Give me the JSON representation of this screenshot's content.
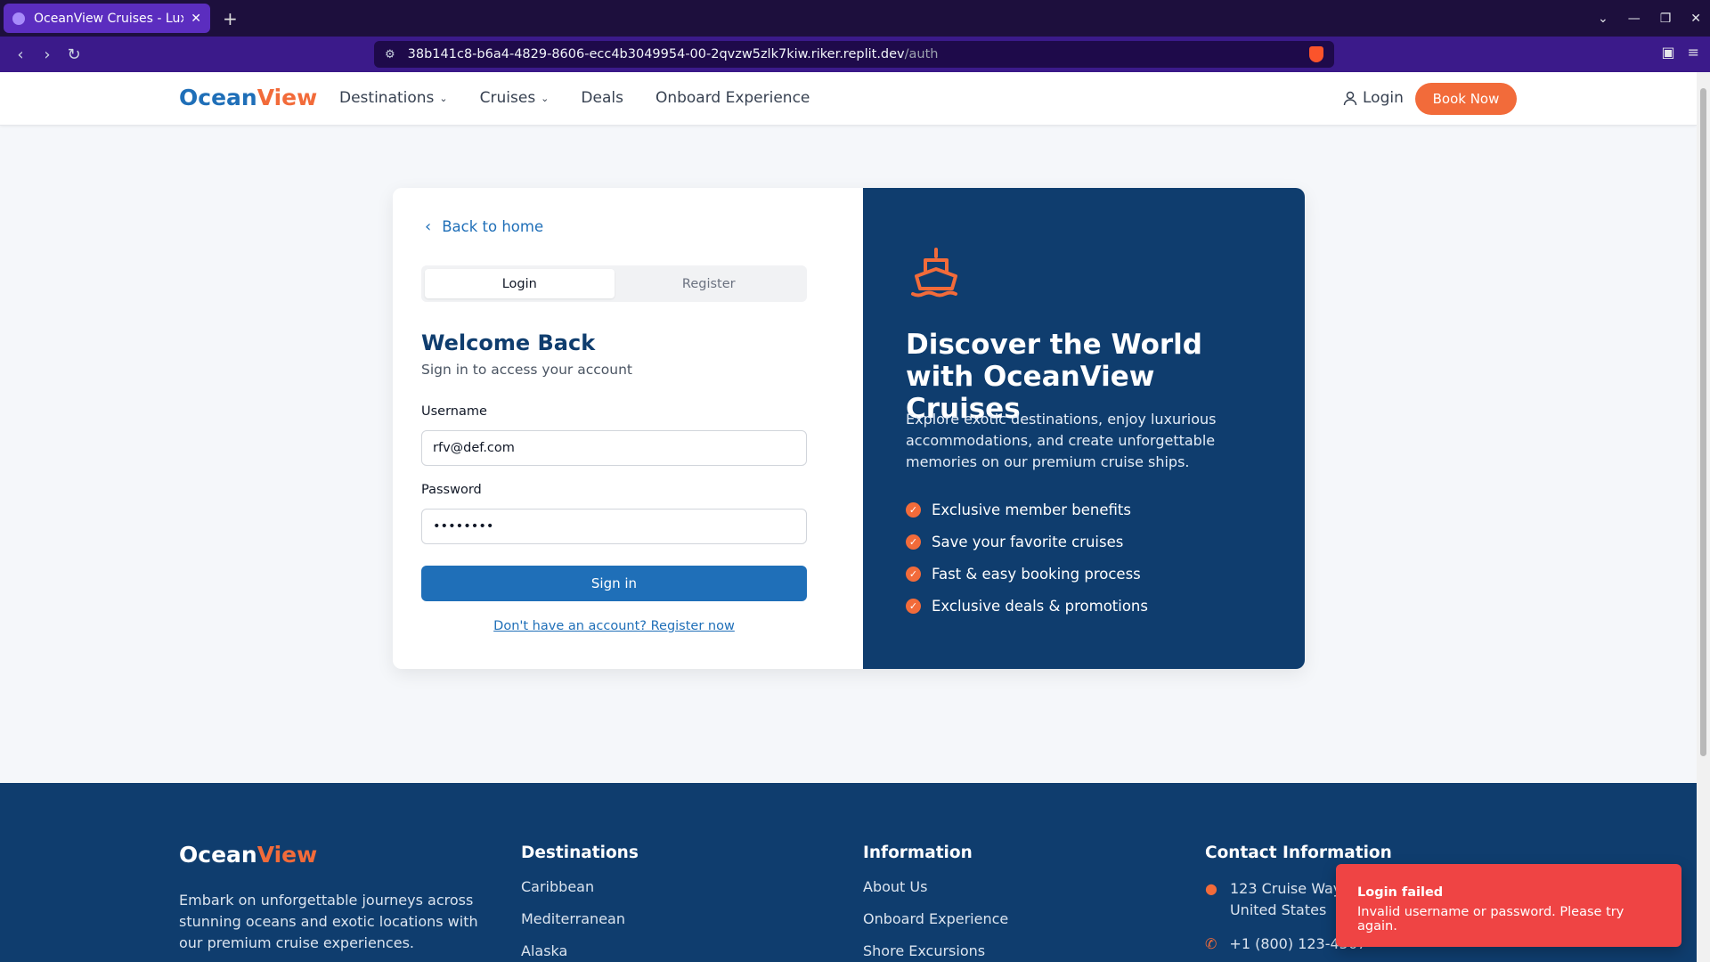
{
  "browser": {
    "tab_title": "OceanView Cruises - Luxury",
    "url_host": "38b141c8-b6a4-4829-8606-ecc4b3049954-00-2qvzw5zlk7kiw.riker.replit.dev",
    "url_path": "/auth"
  },
  "header": {
    "logo_part1": "Ocean",
    "logo_part2": "View",
    "nav": [
      "Destinations",
      "Cruises",
      "Deals",
      "Onboard Experience"
    ],
    "login": "Login",
    "book_now": "Book Now"
  },
  "auth": {
    "back": "Back to home",
    "tabs": [
      "Login",
      "Register"
    ],
    "active_tab": "Login",
    "title": "Welcome Back",
    "subtitle": "Sign in to access your account",
    "username_label": "Username",
    "username_value": "rfv@def.com",
    "password_label": "Password",
    "password_value": "••••••••",
    "signin": "Sign in",
    "register_link": "Don't have an account? Register now"
  },
  "promo": {
    "title": "Discover the World with OceanView Cruises",
    "description": "Explore exotic destinations, enjoy luxurious accommodations, and create unforgettable memories on our premium cruise ships.",
    "benefits": [
      "Exclusive member benefits",
      "Save your favorite cruises",
      "Fast & easy booking process",
      "Exclusive deals & promotions"
    ]
  },
  "footer": {
    "logo_part1": "Ocean",
    "logo_part2": "View",
    "description": "Embark on unforgettable journeys across stunning oceans and exotic locations with our premium cruise experiences.",
    "destinations_title": "Destinations",
    "destinations": [
      "Caribbean",
      "Mediterranean",
      "Alaska"
    ],
    "information_title": "Information",
    "information": [
      "About Us",
      "Onboard Experience",
      "Shore Excursions"
    ],
    "contact_title": "Contact Information",
    "address": "123 Cruise Way, Miami, FL 33101, United States",
    "phone": "+1 (800) 123-4567"
  },
  "toast": {
    "title": "Login failed",
    "message": "Invalid username or password. Please try again."
  },
  "colors": {
    "brand_blue": "#1f6fb8",
    "brand_orange": "#f26b3a",
    "navy": "#0f3d6e",
    "error": "#ef4444"
  }
}
